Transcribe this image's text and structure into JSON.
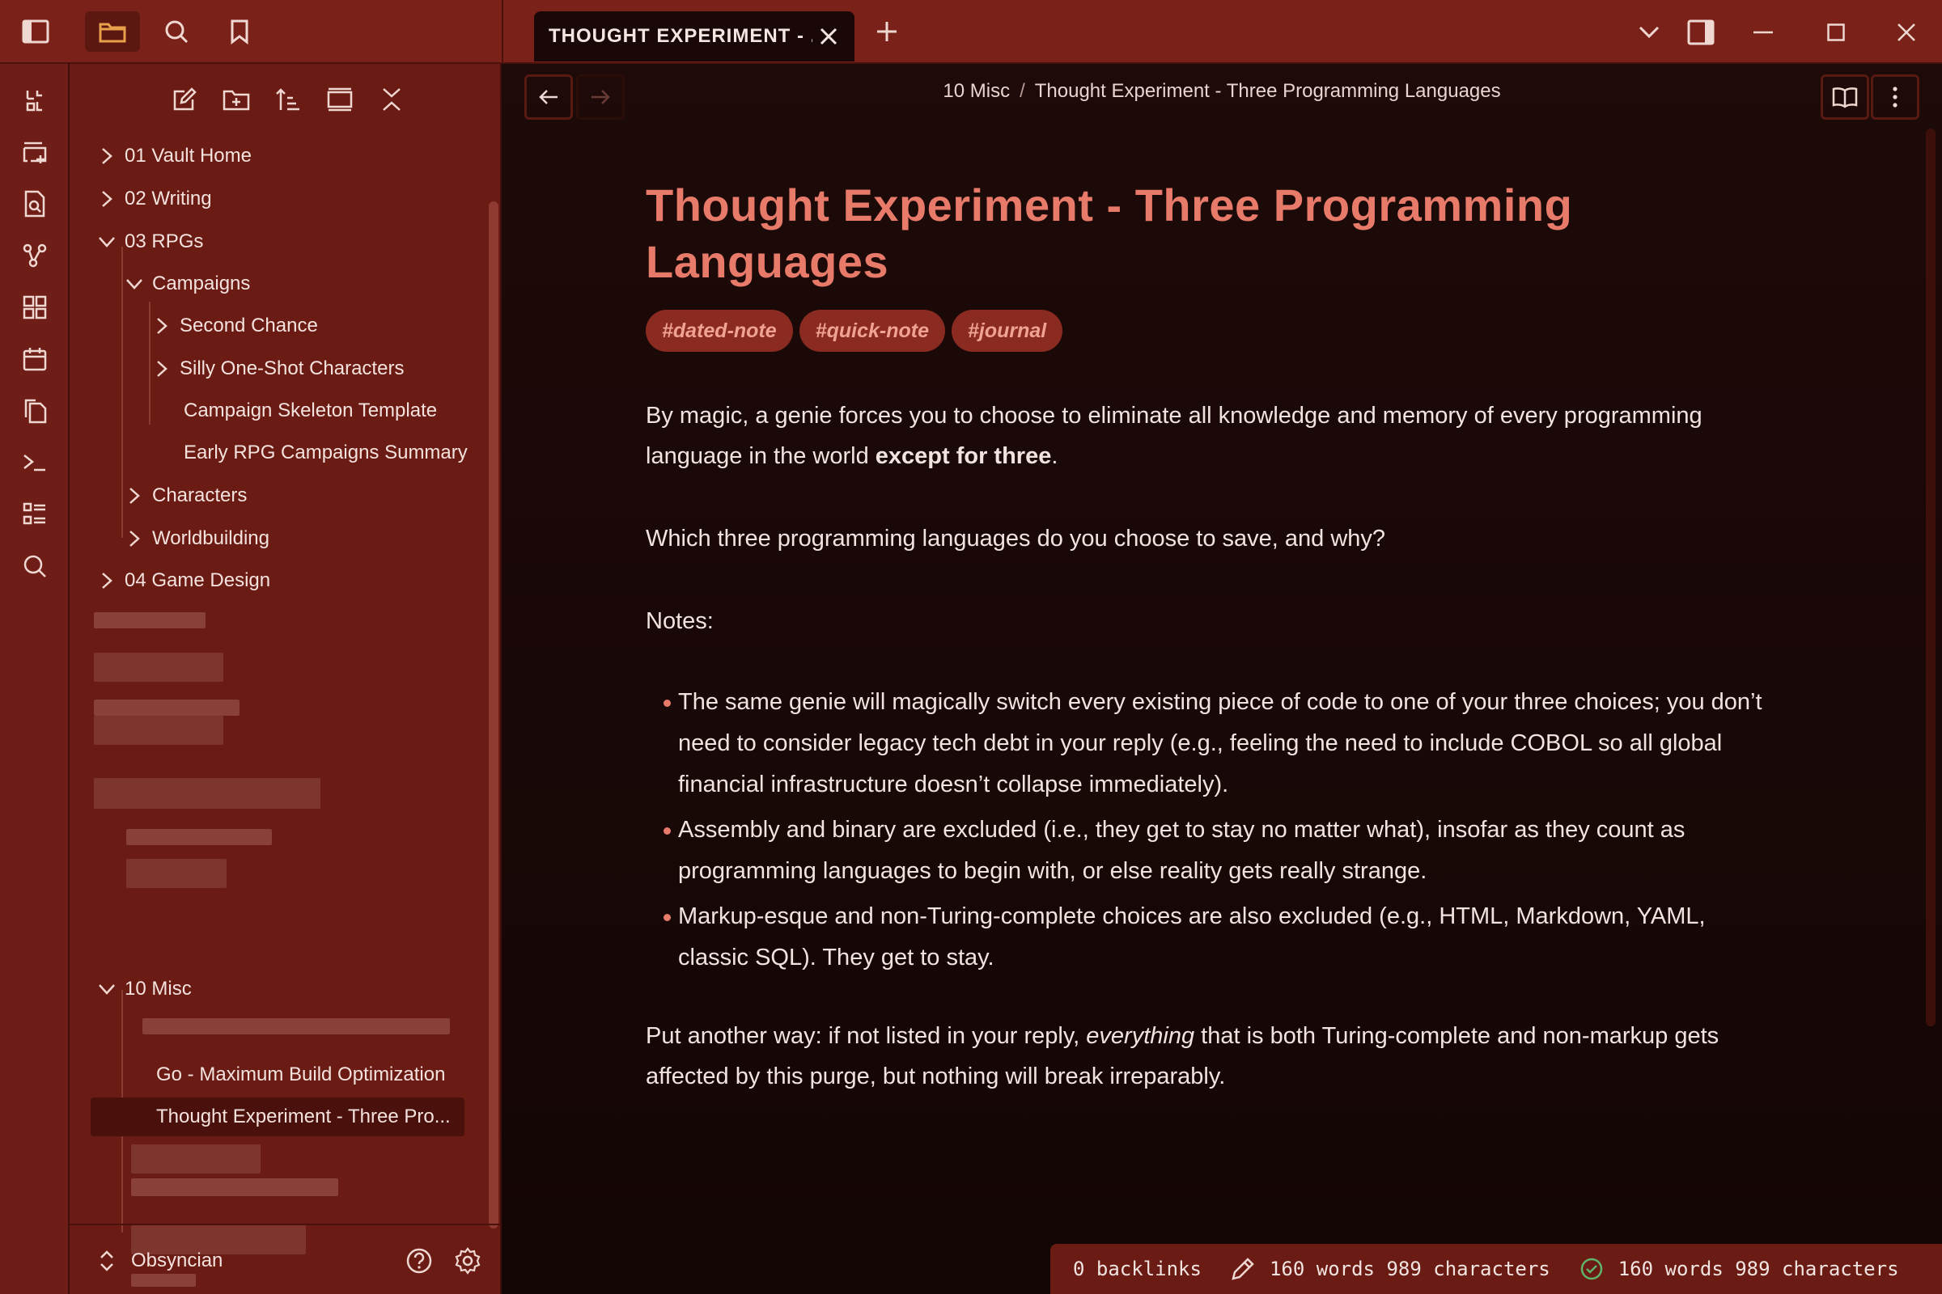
{
  "tab": {
    "title": "THOUGHT EXPERIMENT - ..."
  },
  "breadcrumb": {
    "folder": "10 Misc",
    "separator": "/",
    "note": "Thought Experiment - Three Programming Languages"
  },
  "sidebar": {
    "tree": [
      {
        "label": "01 Vault Home",
        "expanded": false
      },
      {
        "label": "02 Writing",
        "expanded": false
      },
      {
        "label": "03 RPGs",
        "expanded": true
      },
      {
        "label": "Campaigns",
        "expanded": true
      },
      {
        "label": "Second Chance",
        "expanded": false
      },
      {
        "label": "Silly One-Shot Characters",
        "expanded": false
      },
      {
        "label": "Campaign Skeleton Template"
      },
      {
        "label": "Early RPG Campaigns Summary"
      },
      {
        "label": "Characters",
        "expanded": false
      },
      {
        "label": "Worldbuilding",
        "expanded": false
      },
      {
        "label": "04 Game Design",
        "expanded": false
      },
      {
        "label": "10 Misc",
        "expanded": true
      },
      {
        "label": "Go - Maximum Build Optimization"
      },
      {
        "label": "Thought Experiment - Three Pro...",
        "selected": true
      }
    ],
    "vault_name": "Obsyncian"
  },
  "note": {
    "title": "Thought Experiment - Three Programming Languages",
    "tags": [
      "#dated-note",
      "#quick-note",
      "#journal"
    ],
    "p1_a": "By magic, a genie forces you to choose to eliminate all knowledge and memory of every programming language in the world ",
    "p1_bold": "except for three",
    "p1_end": ".",
    "p2": "Which three programming languages do you choose to save, and why?",
    "p3": "Notes:",
    "bullets": [
      "The same genie will magically switch every existing piece of code to one of your three choices; you don’t need to consider legacy tech debt in your reply (e.g., feeling the need to include COBOL so all global financial infrastructure doesn’t collapse immediately).",
      "Assembly and binary are excluded (i.e., they get to stay no matter what), insofar as they count as programming languages to begin with, or else reality gets really strange.",
      "Markup-esque and non-Turing-complete choices are also excluded (e.g., HTML, Markdown, YAML, classic SQL). They get to stay."
    ],
    "p4_a": "Put another way: if not listed in your reply, ",
    "p4_em": "everything",
    "p4_b": " that is both Turing-complete and non-markup gets affected by this purge, but nothing will break irreparably."
  },
  "status": {
    "backlinks": "0 backlinks",
    "count_a": "160 words 989 characters",
    "count_b": "160 words 989 characters"
  },
  "colors": {
    "accent": "#e87a6a",
    "tag_bg": "#8a2a20",
    "chrome": "#7a2219",
    "background": "#1a0b0a"
  }
}
